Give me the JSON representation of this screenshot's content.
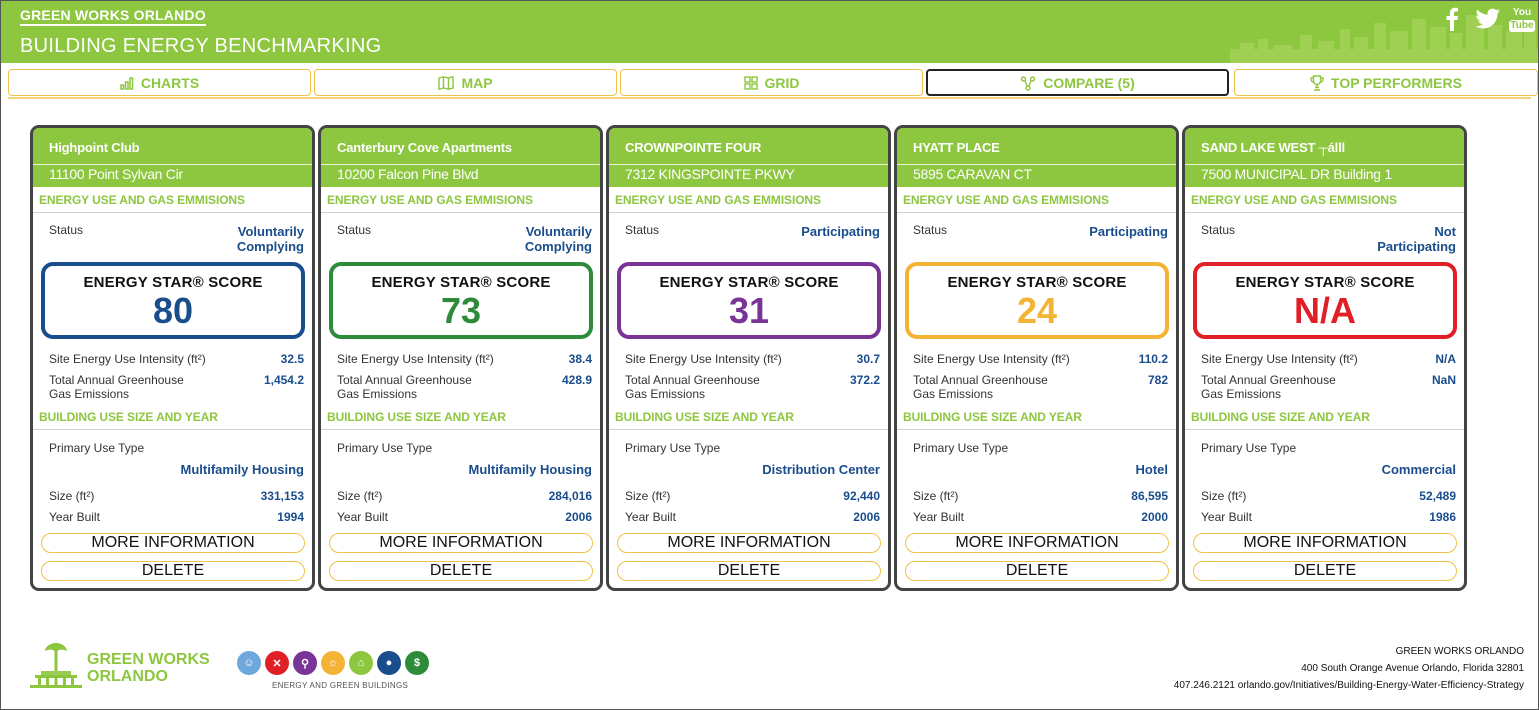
{
  "header": {
    "brand": "GREEN WORKS ORLANDO",
    "subtitle": "BUILDING ENERGY BENCHMARKING",
    "accent_color": "#8dc63f",
    "social": [
      {
        "name": "facebook-icon",
        "glyph": "f"
      },
      {
        "name": "twitter-icon",
        "glyph": "t"
      },
      {
        "name": "youtube-icon",
        "glyph": "You Tube"
      }
    ]
  },
  "tabs": [
    {
      "label": "CHARTS",
      "icon": "bar-chart-icon",
      "active": false
    },
    {
      "label": "MAP",
      "icon": "map-icon",
      "active": false
    },
    {
      "label": "GRID",
      "icon": "grid-icon",
      "active": false
    },
    {
      "label": "COMPARE (5)",
      "icon": "compare-icon",
      "active": true
    },
    {
      "label": "TOP PERFORMERS",
      "icon": "trophy-icon",
      "active": false
    }
  ],
  "labels": {
    "energy_section": "ENERGY USE AND GAS EMMISIONS",
    "building_section": "BUILDING USE SIZE AND YEAR",
    "status": "Status",
    "energy_star": "ENERGY STAR® SCORE",
    "site_eui": "Site Energy Use Intensity (ft²)",
    "ghg_line1": "Total Annual Greenhouse",
    "ghg_line2": "Gas Emissions",
    "primary_use": "Primary Use Type",
    "size": "Size (ft²)",
    "year_built": "Year Built",
    "more_info": "MORE INFORMATION",
    "delete": "DELETE"
  },
  "cards": [
    {
      "name": "Highpoint Club",
      "address": "11100 Point Sylvan Cir",
      "status_line1": "Voluntarily",
      "status_line2": "Complying",
      "score": "80",
      "score_color": "#1a4d8c",
      "eui": "32.5",
      "ghg": "1,454.2",
      "use_type": "Multifamily Housing",
      "size": "331,153",
      "year": "1994"
    },
    {
      "name": "Canterbury Cove Apartments",
      "address": "10200 Falcon Pine Blvd",
      "status_line1": "Voluntarily",
      "status_line2": "Complying",
      "score": "73",
      "score_color": "#2e8b3a",
      "eui": "38.4",
      "ghg": "428.9",
      "use_type": "Multifamily Housing",
      "size": "284,016",
      "year": "2006"
    },
    {
      "name": "CROWNPOINTE FOUR",
      "address": "7312 KINGSPOINTE PKWY",
      "status_line1": "Participating",
      "status_line2": "",
      "score": "31",
      "score_color": "#7a3396",
      "eui": "30.7",
      "ghg": "372.2",
      "use_type": "Distribution Center",
      "size": "92,440",
      "year": "2006"
    },
    {
      "name": "HYATT PLACE",
      "address": "5895 CARAVAN CT",
      "status_line1": "Participating",
      "status_line2": "",
      "score": "24",
      "score_color": "#f5b335",
      "eui": "110.2",
      "ghg": "782",
      "use_type": "Hotel",
      "size": "86,595",
      "year": "2000"
    },
    {
      "name": "SAND LAKE WEST ┬álll",
      "address": "7500 MUNICIPAL DR Building 1",
      "status_line1": "Not",
      "status_line2": "Participating",
      "score": "N/A",
      "score_color": "#e02026",
      "eui": "N/A",
      "ghg": "NaN",
      "use_type": "Commercial",
      "size": "52,489",
      "year": "1986"
    }
  ],
  "footer": {
    "logo_line1": "GREEN WORKS",
    "logo_line2": "ORLANDO",
    "caption": "ENERGY AND GREEN BUILDINGS",
    "org": "GREEN WORKS ORLANDO",
    "address": "400 South Orange Avenue  Orlando, Florida 32801",
    "contact": "407.246.2121  orlando.gov/Initiatives/Building-Energy-Water-Efficiency-Strategy",
    "category_icons": [
      {
        "name": "community-icon",
        "color": "#6fa8dc"
      },
      {
        "name": "food-icon",
        "color": "#e02026"
      },
      {
        "name": "transport-icon",
        "color": "#7a3396"
      },
      {
        "name": "energy-bulb-icon",
        "color": "#f5b335"
      },
      {
        "name": "green-building-icon",
        "color": "#8dc63f"
      },
      {
        "name": "water-drop-icon",
        "color": "#1a4d8c"
      },
      {
        "name": "economy-icon",
        "color": "#2e8b3a"
      }
    ]
  }
}
